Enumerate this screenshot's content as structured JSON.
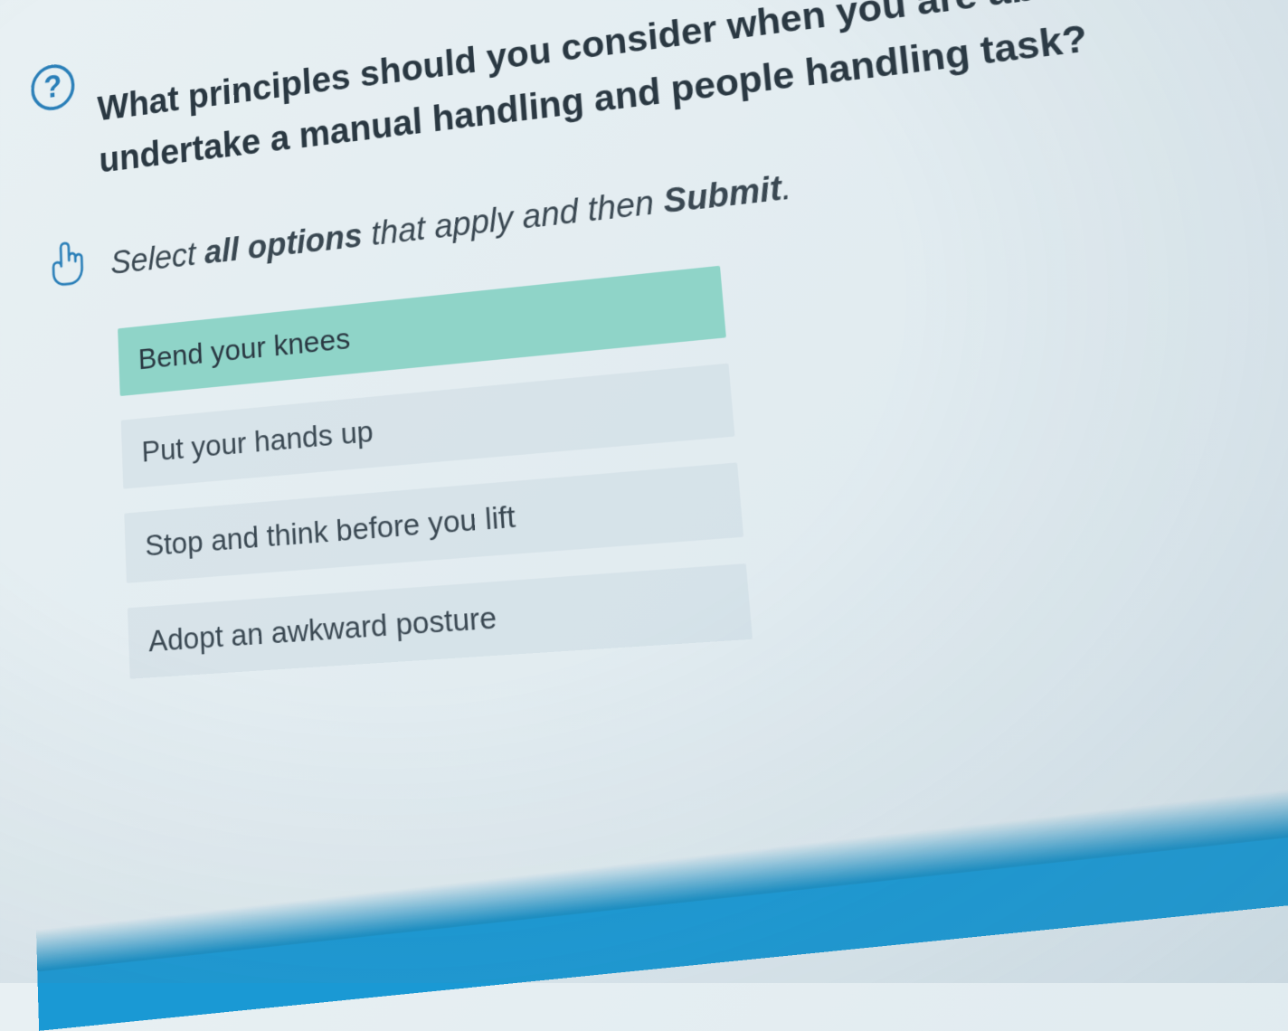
{
  "question": {
    "icon_label": "?",
    "text": "What principles should you consider when you are about to undertake a manual handling and people handling task?"
  },
  "instruction": {
    "prefix": "Select ",
    "emphasis1": "all options",
    "middle": " that apply and then ",
    "emphasis2": "Submit",
    "suffix": "."
  },
  "options": [
    {
      "label": "Bend your knees",
      "selected": true
    },
    {
      "label": "Put your hands up",
      "selected": false
    },
    {
      "label": "Stop and think before you lift",
      "selected": false
    },
    {
      "label": "Adopt an awkward posture",
      "selected": false
    }
  ],
  "colors": {
    "accent": "#2a7fb8",
    "selected_bg": "#8fd4c8",
    "footer": "#1a99d4"
  }
}
